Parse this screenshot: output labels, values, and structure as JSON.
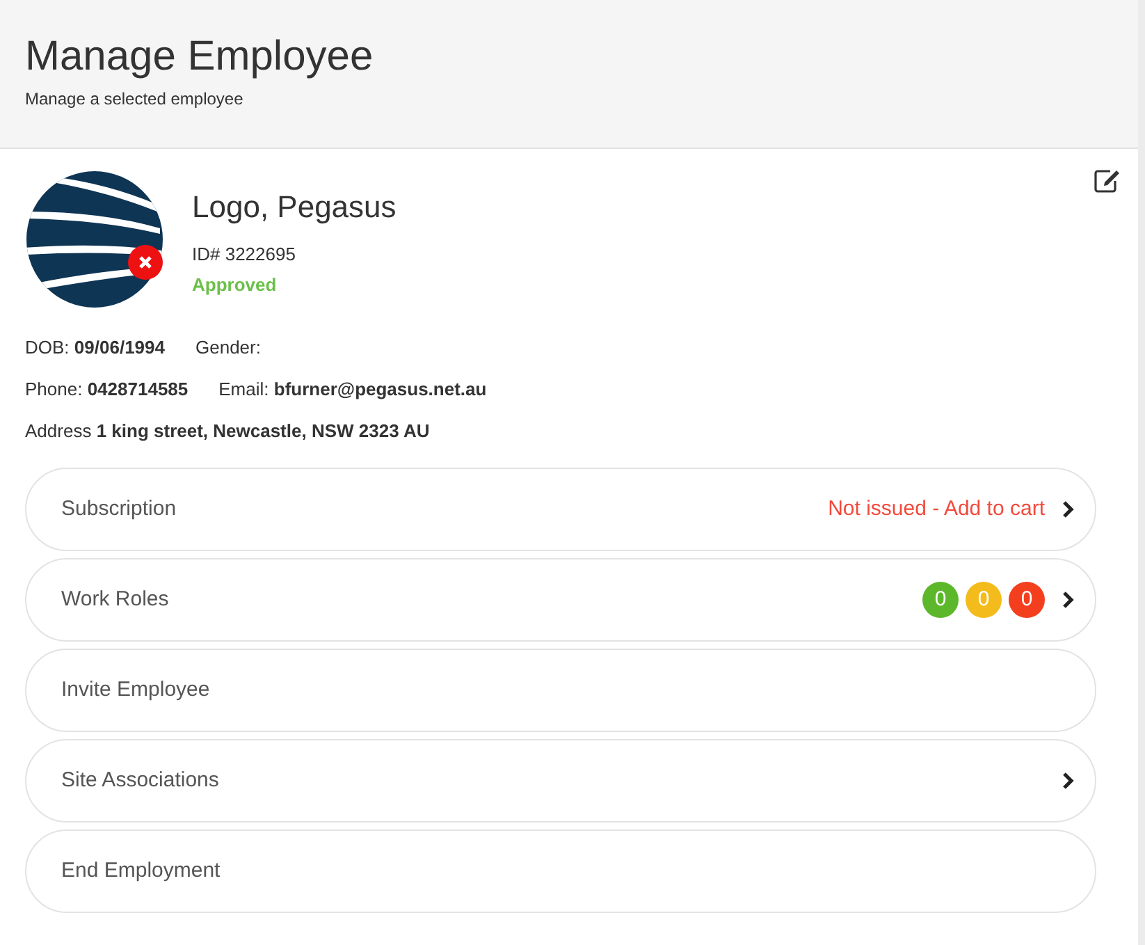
{
  "header": {
    "title": "Manage Employee",
    "subtitle": "Manage a selected employee"
  },
  "employee": {
    "name": "Logo, Pegasus",
    "id": "ID# 3222695",
    "status": "Approved"
  },
  "details": [
    [
      {
        "label": "DOB:",
        "value": "09/06/1994"
      },
      {
        "label": "Gender:"
      }
    ],
    [
      {
        "label": "Phone:",
        "value": "0428714585"
      },
      {
        "label": "Email:",
        "value": "bfurner@pegasus.net.au"
      }
    ],
    [
      {
        "label": "Address",
        "value": "1 king street, Newcastle, NSW 2323 AU"
      }
    ]
  ],
  "rows": [
    {
      "label": "Subscription",
      "kind": "status",
      "status": "Not issued - Add to cart",
      "chevron": true
    },
    {
      "label": "Work Roles",
      "kind": "counts",
      "counts": [
        {
          "value": "0",
          "color": "#5cb82a"
        },
        {
          "value": "0",
          "color": "#f4bb1c"
        },
        {
          "value": "0",
          "color": "#f43f1e"
        }
      ],
      "chevron": true
    },
    {
      "label": "Invite Employee",
      "kind": "plain",
      "chevron": false
    },
    {
      "label": "Site Associations",
      "kind": "plain",
      "chevron": true
    },
    {
      "label": "End Employment",
      "kind": "plain",
      "chevron": false
    }
  ]
}
